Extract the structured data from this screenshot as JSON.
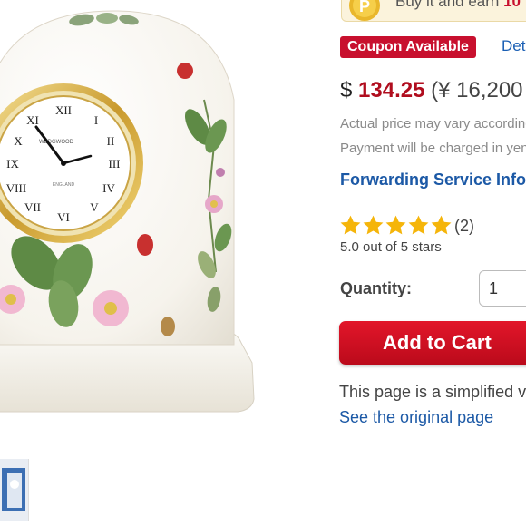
{
  "promo": {
    "text": "Buy it and earn",
    "highlight": "10"
  },
  "coupon": {
    "badge": "Coupon Available",
    "details_link": "Det"
  },
  "price": {
    "currency": "$",
    "amount": "134.25",
    "alt": "(¥ 16,200"
  },
  "notes": {
    "actual_price": "Actual price may vary according",
    "payment": "Payment will be charged in yen"
  },
  "forwarding": {
    "label": "Forwarding Service Info"
  },
  "rating": {
    "stars": 5,
    "max": 5,
    "count": "(2)",
    "text": "5.0 out of 5 stars"
  },
  "quantity": {
    "label": "Quantity:",
    "value": "1"
  },
  "cart": {
    "button_label": "Add to Cart"
  },
  "footer": {
    "simplified_text": "This page is a simplified v",
    "original_link": "See the original page"
  },
  "product_image": {
    "brand_text": "WEDGWOOD",
    "origin_text": "ENGLAND"
  },
  "colors": {
    "accent_red": "#c8102e",
    "link_blue": "#1c59a6",
    "star_gold": "#f5b50a"
  }
}
